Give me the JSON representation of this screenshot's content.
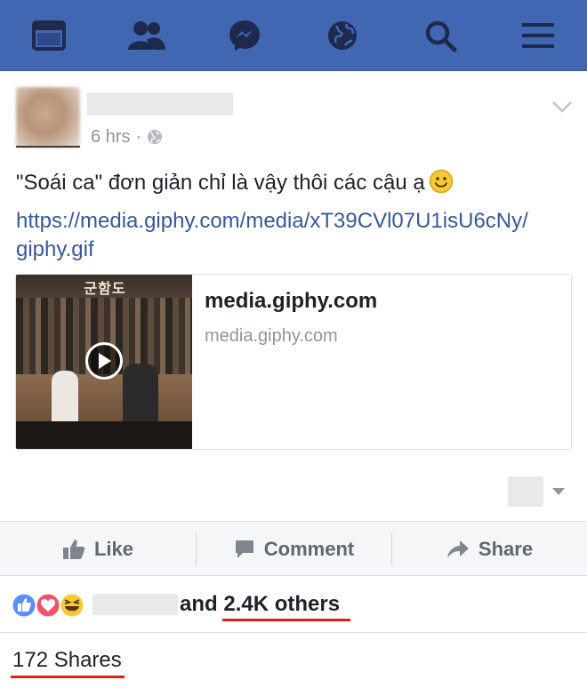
{
  "navbar": {
    "items": [
      {
        "name": "news-feed-icon"
      },
      {
        "name": "friends-icon"
      },
      {
        "name": "messenger-icon"
      },
      {
        "name": "notifications-globe-icon"
      },
      {
        "name": "search-icon"
      },
      {
        "name": "menu-icon"
      }
    ],
    "color": "#4267b2"
  },
  "post": {
    "time": "6 hrs",
    "separator": "·",
    "text": "\"Soái ca\" đơn giản chỉ là vậy thôi các cậu ạ",
    "link_line1": "https://media.giphy.com/media/xT39CVl07U1isU6cNy/",
    "link_line2": "giphy.gif",
    "card": {
      "title": "media.giphy.com",
      "subtitle": "media.giphy.com",
      "thumb_banner": "군함도"
    }
  },
  "actions": {
    "like_label": "Like",
    "comment_label": "Comment",
    "share_label": "Share"
  },
  "reactions": {
    "icons": [
      "like-reaction-icon",
      "love-reaction-icon",
      "haha-reaction-icon"
    ],
    "and_label": "and",
    "others_label": "2.4K others"
  },
  "shares": {
    "label": "172 Shares"
  },
  "colors": {
    "brand": "#4267b2",
    "link": "#365899",
    "muted": "#90949c",
    "underline_annotation": "#e0201f"
  }
}
